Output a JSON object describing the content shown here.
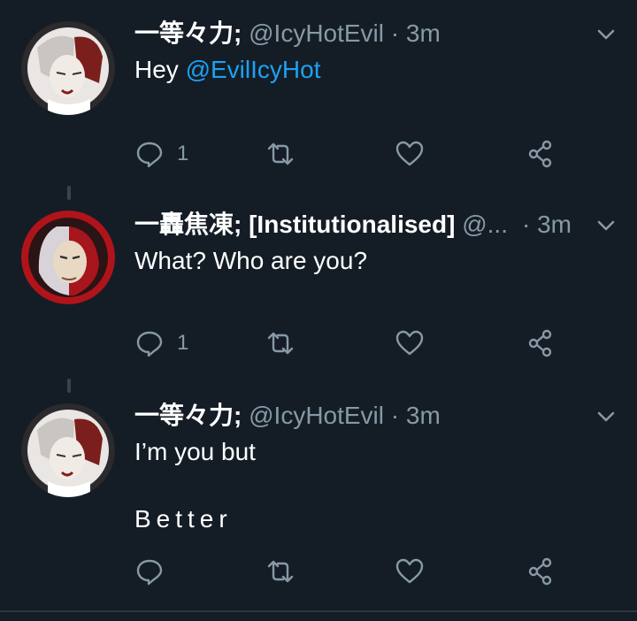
{
  "tweets": [
    {
      "name": "一等々力;",
      "handle": "@IcyHotEvil",
      "dot": "·",
      "time": "3m",
      "text_prefix": "Hey ",
      "mention": "@EvilIcyHot",
      "reply_count": "1"
    },
    {
      "name": "一轟焦凍; [Institutionalised]",
      "handle": "@...",
      "dot": "·",
      "time": "3m",
      "text": "What? Who are you?",
      "reply_count": "1"
    },
    {
      "name": "一等々力;",
      "handle": "@IcyHotEvil",
      "dot": "·",
      "time": "3m",
      "text_line1": "I’m you but",
      "text_line2": "Better",
      "reply_count": ""
    }
  ],
  "colors": {
    "background": "#141d26",
    "secondary_text": "#8899a6",
    "link": "#1da1f2"
  },
  "icons": [
    "chevron-down-icon",
    "reply-icon",
    "retweet-icon",
    "like-icon",
    "share-icon"
  ]
}
